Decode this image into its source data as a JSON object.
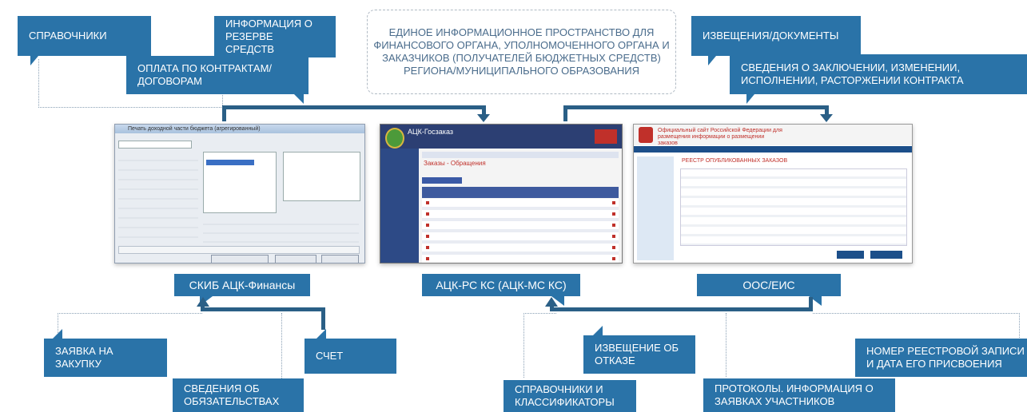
{
  "title": "ЕДИНОЕ ИНФОРМАЦИОННОЕ ПРОСТРАНСТВО ДЛЯ ФИНАНСОВОГО ОРГАНА, УПОЛНОМОЧЕННОГО ОРГАНА И ЗАКАЗЧИКОВ (ПОЛУЧАТЕЛЕЙ БЮДЖЕТНЫХ СРЕДСТВ) РЕГИОНА/МУНИЦИПАЛЬНОГО ОБРАЗОВАНИЯ",
  "top_boxes": {
    "spravochniki": "СПРАВОЧНИКИ",
    "rezerv": "ИНФОРМАЦИЯ О РЕЗЕРВЕ СРЕДСТВ",
    "oplata": "ОПЛАТА ПО КОНТРАКТАМ/ДОГОВОРАМ",
    "izvescheniya": "ИЗВЕЩЕНИЯ/ДОКУМЕНТЫ",
    "svedeniya_kontrakt": "СВЕДЕНИЯ О ЗАКЛЮЧЕНИИ, ИЗМЕНЕНИИ, ИСПОЛНЕНИИ, РАСТОРЖЕНИИ КОНТРАКТА"
  },
  "systems": {
    "left": "СКИБ АЦК-Финансы",
    "middle": "АЦК-РС КС (АЦК-МС КС)",
    "right": "ООС/ЕИС"
  },
  "bottom_boxes": {
    "zayavka": "ЗАЯВКА НА ЗАКУПКУ",
    "schet": "СЧЕТ",
    "svedeniya_obyaz": "СВЕДЕНИЯ ОБ ОБЯЗАТЕЛЬСТВАХ",
    "otkaz": "ИЗВЕЩЕНИЕ ОБ ОТКАЗЕ",
    "sprav_klass": "СПРАВОЧНИКИ И КЛАССИФИКАТОРЫ",
    "protokoly": "ПРОТОКОЛЫ. ИНФОРМАЦИЯ О ЗАЯВКАХ УЧАСТНИКОВ",
    "nomer": "НОМЕР РЕЕСТРОВОЙ ЗАПИСИ И ДАТА ЕГО ПРИСВОЕНИЯ"
  },
  "screens": {
    "left_window_title": "Печать доходной части бюджета (агрегированный)",
    "middle_app": "АЦК-Госзаказ",
    "middle_heading": "Заказы - Обращения",
    "right_heading": "РЕЕСТР ОПУБЛИКОВАННЫХ ЗАКАЗОВ",
    "right_site": "Официальный сайт Российской Федерации для размещения информации о размещении заказов"
  },
  "colors": {
    "box": "#2a73a8",
    "arrow": "#2a5f86",
    "title_text": "#4a6c8c"
  }
}
